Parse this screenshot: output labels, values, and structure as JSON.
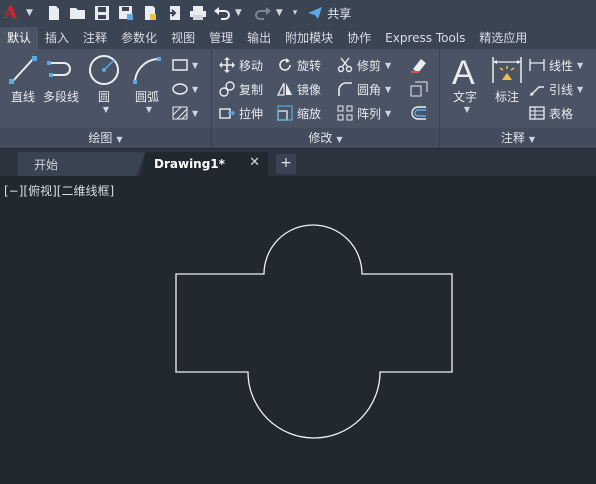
{
  "app": {
    "logo_letter": "A",
    "share_label": "共享"
  },
  "ribbon_tabs": [
    "默认",
    "插入",
    "注释",
    "参数化",
    "视图",
    "管理",
    "输出",
    "附加模块",
    "协作",
    "Express Tools",
    "精选应用"
  ],
  "active_tab_index": 0,
  "panels": {
    "draw": {
      "title": "绘图",
      "line": "直线",
      "polyline": "多段线",
      "circle": "圆",
      "arc": "圆弧"
    },
    "modify": {
      "title": "修改",
      "move": "移动",
      "rotate": "旋转",
      "trim": "修剪",
      "copy": "复制",
      "mirror": "镜像",
      "fillet": "圆角",
      "stretch": "拉伸",
      "scale": "缩放",
      "array": "阵列"
    },
    "annotation": {
      "title": "注释",
      "text": "文字",
      "dimension": "标注",
      "linear": "线性",
      "leader": "引线",
      "table": "表格"
    }
  },
  "file_tabs": {
    "start": "开始",
    "drawing": "Drawing1*"
  },
  "viewport_label": "[−][俯视][二维线框]",
  "colors": {
    "background": "#212830",
    "ribbon": "#4a5465",
    "accent": "#5aa9e6",
    "logo": "#e02020"
  }
}
